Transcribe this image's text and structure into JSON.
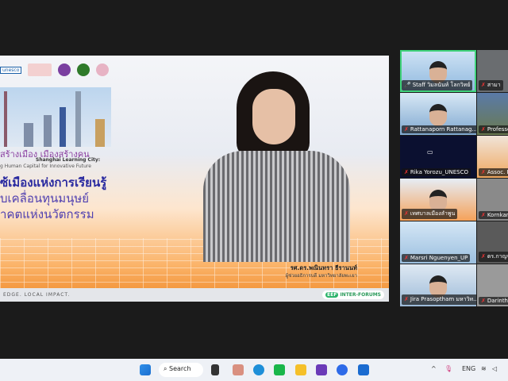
{
  "slide": {
    "title_line1": "สร้างเมือง เมืองสร้างคน",
    "subtitle_en1": "Shanghai Learning City:",
    "subtitle_en2": "g Human Capital for Innovative Future",
    "headline1": "ซ้เมืองแห่งการเรียนรู้",
    "headline2": "บเคลื่อนทุนมนุษย์",
    "headline3": "าคตแห่งนวัตกรรม",
    "footer": "EDGE. LOCAL IMPACT.",
    "badge_mark": "EEF",
    "badge_text": "INTER-FORUMS",
    "logo_unesco": "unesco",
    "speaker_name": "รศ.ดร.พณินทรา ธีรานนท์",
    "speaker_title": "ผู้ช่วยอธิการบดี มหาวิทยาลัยพะเยา"
  },
  "gallery": {
    "col1": [
      {
        "name": "Staff วิมลนันท์ โลกวิทย์",
        "muted": false,
        "active": true
      },
      {
        "name": "Rattanaporn Rattanag...",
        "muted": true
      },
      {
        "name": "Rika Yorozu_UNESCO",
        "muted": true,
        "logo": "unesco"
      },
      {
        "name": "เทศบาลเมืองลำพูน",
        "muted": true
      },
      {
        "name": "Marsri Nguenyen_UP",
        "muted": true
      },
      {
        "name": "Jira Prasoptham มหาวิท...",
        "muted": true
      }
    ],
    "col2": [
      {
        "name": "สามา"
      },
      {
        "name": "Professo"
      },
      {
        "name": "Assoc. P"
      },
      {
        "name": "Kornkan"
      },
      {
        "name": "ดร.กาญจ"
      },
      {
        "name": "Darintho"
      }
    ]
  },
  "taskbar": {
    "search": "Search",
    "lang": "ENG",
    "apps": [
      "start-icon",
      "file-explorer-task-view",
      "photos",
      "edge",
      "line",
      "file-explorer",
      "app-purple",
      "zoom",
      "outlook"
    ]
  }
}
